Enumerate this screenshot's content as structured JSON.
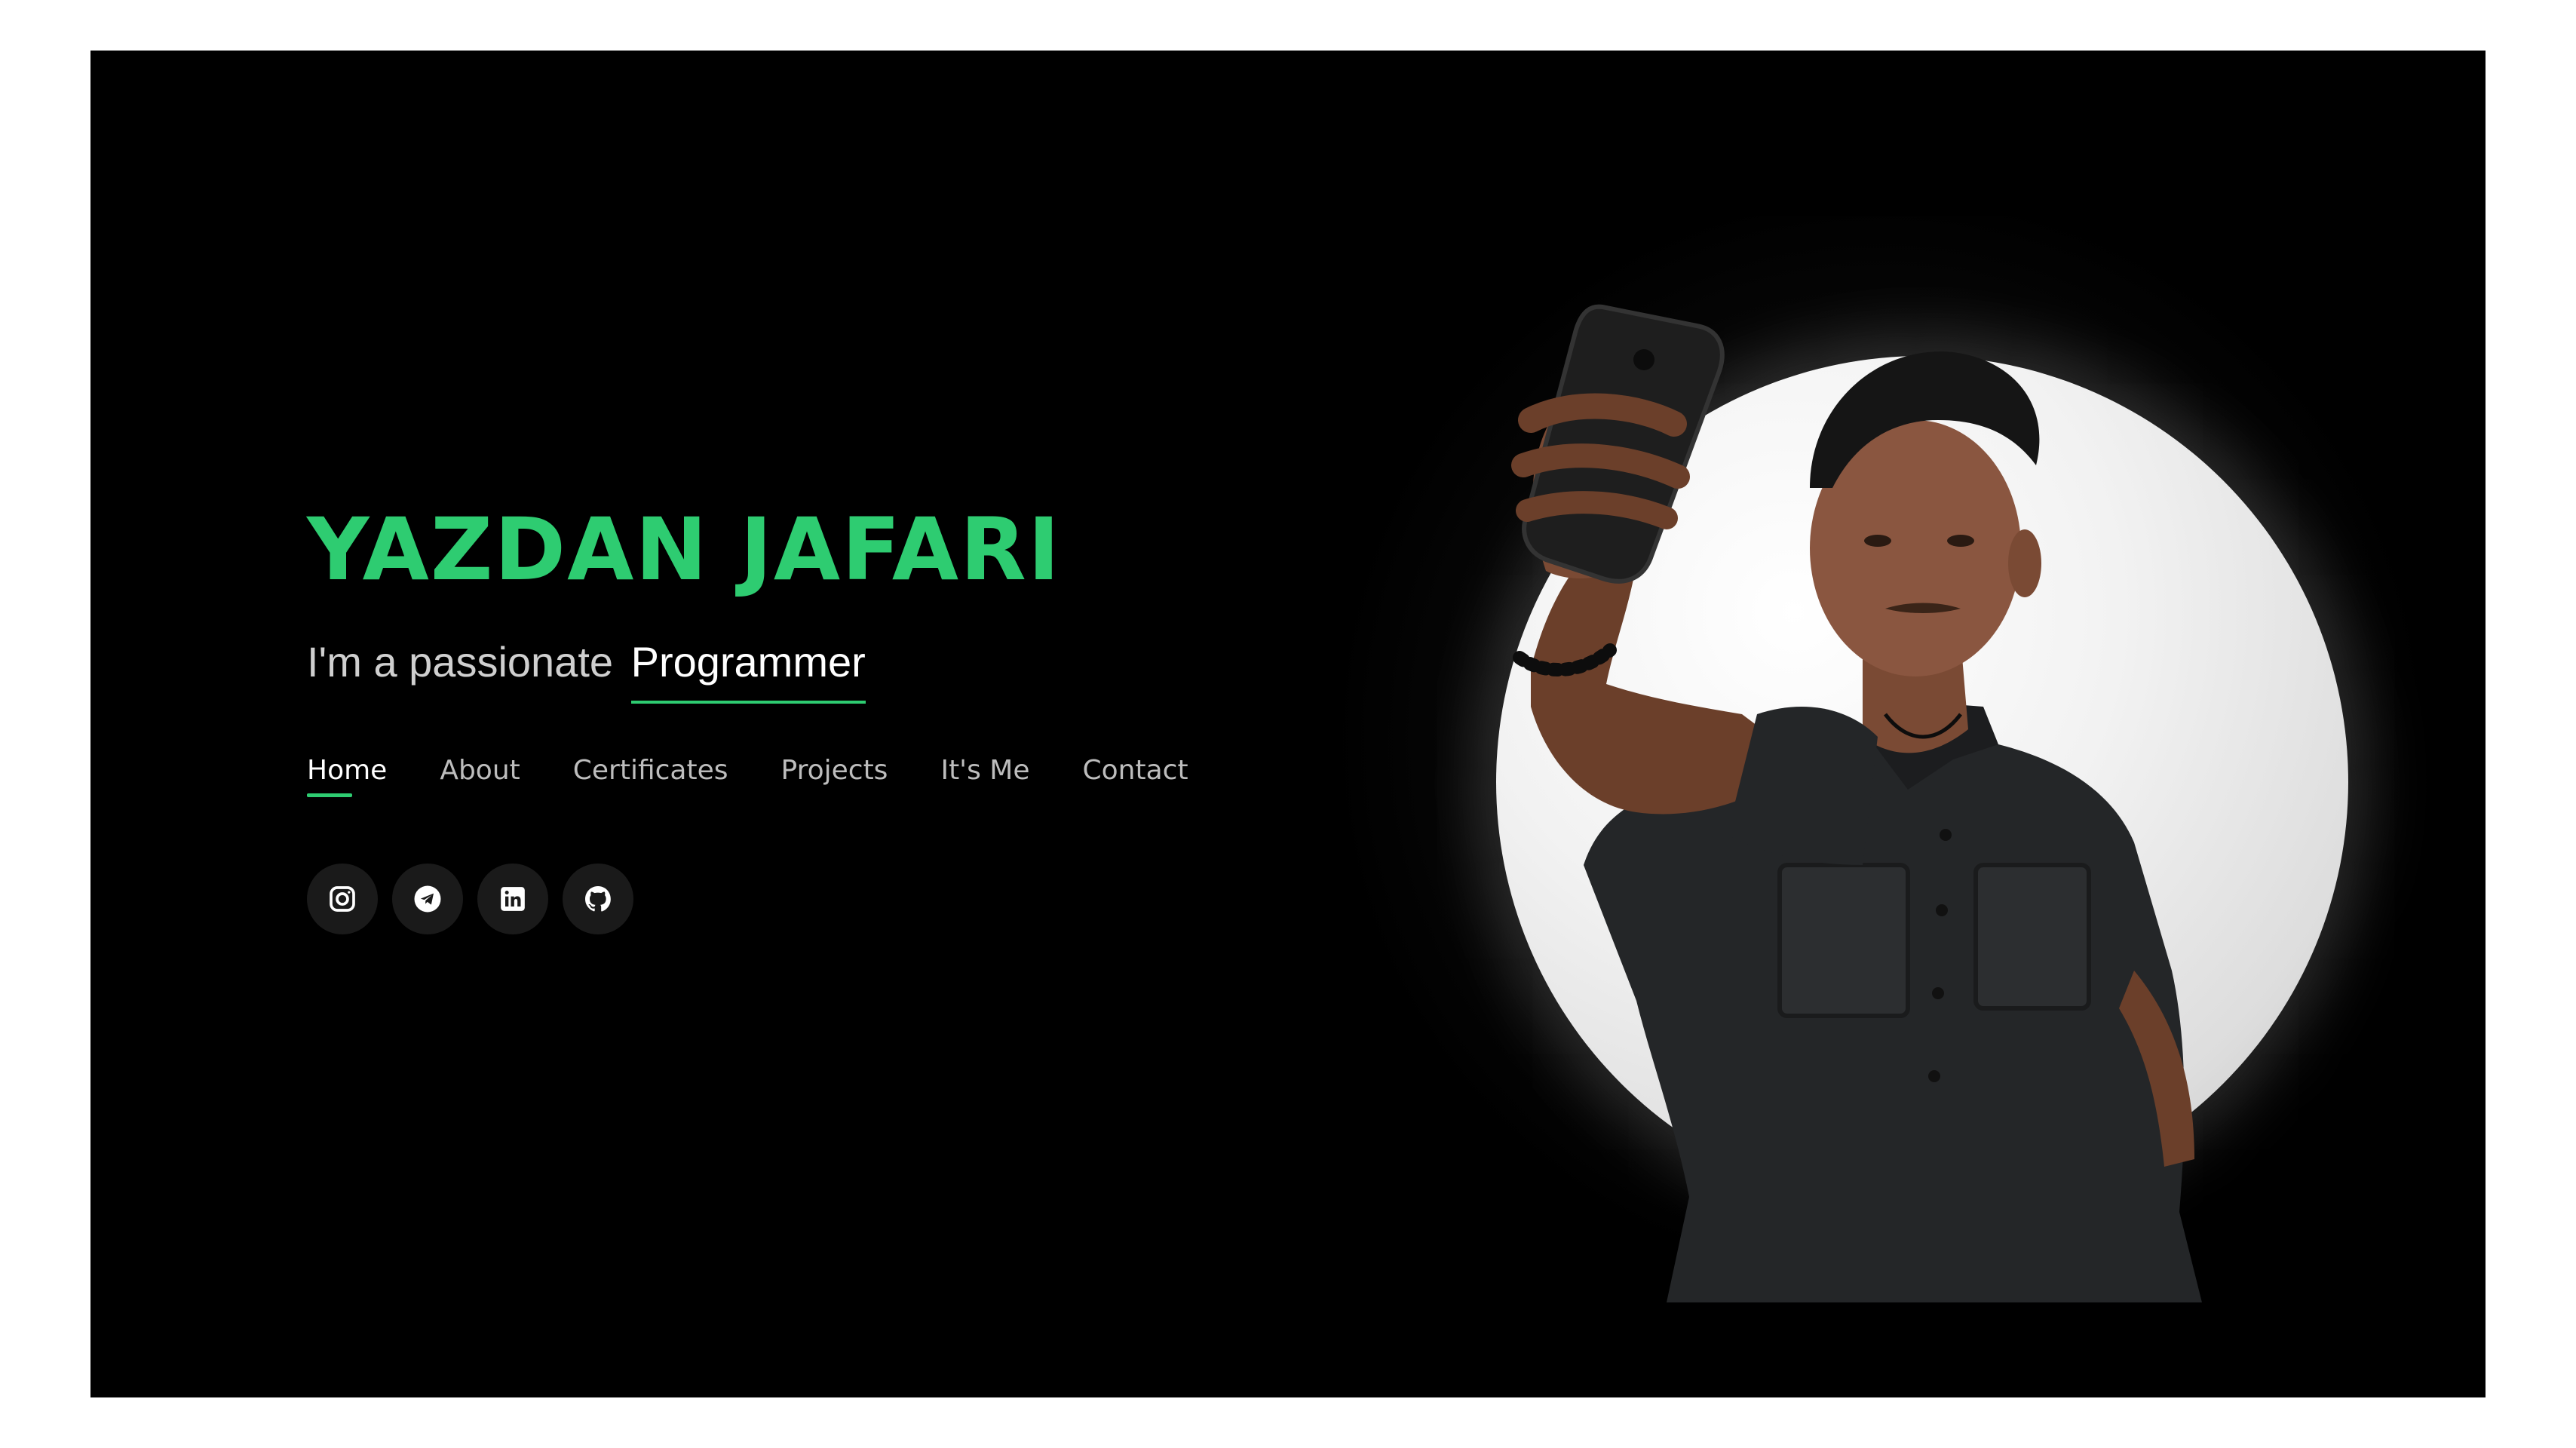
{
  "hero": {
    "name": "YAZDAN JAFARI",
    "tagline_prefix": "I'm a passionate",
    "tagline_role": "Programmer"
  },
  "nav": {
    "items": [
      {
        "label": "Home",
        "active": true
      },
      {
        "label": "About",
        "active": false
      },
      {
        "label": "Certificates",
        "active": false
      },
      {
        "label": "Projects",
        "active": false
      },
      {
        "label": "It's Me",
        "active": false
      },
      {
        "label": "Contact",
        "active": false
      }
    ]
  },
  "socials": [
    {
      "icon": "instagram-icon"
    },
    {
      "icon": "telegram-icon"
    },
    {
      "icon": "linkedin-icon"
    },
    {
      "icon": "github-icon"
    }
  ],
  "colors": {
    "accent": "#2ecc71",
    "background": "#000000",
    "text_primary": "#ffffff",
    "text_secondary": "#bdbdbd"
  }
}
